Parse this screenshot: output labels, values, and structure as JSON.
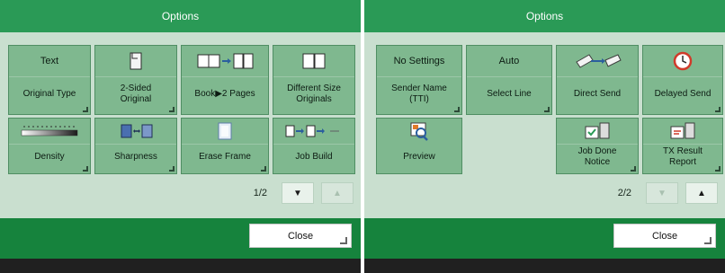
{
  "left_panel": {
    "title": "Options",
    "tiles": [
      {
        "top_text": "Text",
        "label": "Original Type",
        "icon": "text-icon"
      },
      {
        "top_text": "",
        "label": "2-Sided\nOriginal",
        "icon": "two-sided-icon"
      },
      {
        "top_text": "",
        "label": "Book▶2 Pages",
        "icon": "book-icon"
      },
      {
        "top_text": "",
        "label": "Different Size\nOriginals",
        "icon": "different-size-icon"
      },
      {
        "top_text": "",
        "label": "Density",
        "icon": "density-icon"
      },
      {
        "top_text": "",
        "label": "Sharpness",
        "icon": "sharpness-icon"
      },
      {
        "top_text": "",
        "label": "Erase Frame",
        "icon": "erase-frame-icon"
      },
      {
        "top_text": "",
        "label": "Job Build",
        "icon": "job-build-icon"
      }
    ],
    "page_indicator": "1/2",
    "close_label": "Close"
  },
  "right_panel": {
    "title": "Options",
    "tiles": [
      {
        "top_text": "No Settings",
        "label": "Sender Name\n(TTI)",
        "icon": "sender-name-icon"
      },
      {
        "top_text": "Auto",
        "label": "Select Line",
        "icon": "select-line-icon"
      },
      {
        "top_text": "",
        "label": "Direct Send",
        "icon": "direct-send-icon"
      },
      {
        "top_text": "",
        "label": "Delayed Send",
        "icon": "clock-icon"
      },
      {
        "top_text": "",
        "label": "Preview",
        "icon": "preview-icon"
      },
      {
        "top_text": "",
        "label": "Job Done\nNotice",
        "icon": "job-done-icon"
      },
      {
        "top_text": "",
        "label": "TX Result\nReport",
        "icon": "tx-report-icon"
      }
    ],
    "page_indicator": "2/2",
    "close_label": "Close"
  },
  "colors": {
    "title_bar": "#2a9a56",
    "panel_bg": "#c9dfcf",
    "tile_bg": "#7fb88f",
    "footer": "#16833d",
    "bottom_bar": "#202020"
  }
}
